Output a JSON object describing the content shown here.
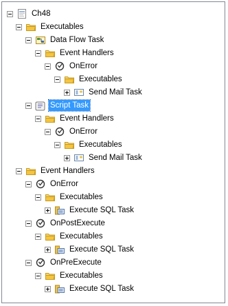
{
  "tree": {
    "root": "Ch48",
    "n_executables": "Executables",
    "n_dataflow": "Data Flow Task",
    "n_df_eh": "Event Handlers",
    "n_df_onerror": "OnError",
    "n_df_exec": "Executables",
    "n_df_sendmail": "Send Mail Task",
    "n_script": "Script Task",
    "n_sc_eh": "Event Handlers",
    "n_sc_onerror": "OnError",
    "n_sc_exec": "Executables",
    "n_sc_sendmail": "Send Mail Task",
    "n_eventhandlers": "Event Handlers",
    "n_onerror": "OnError",
    "n_onerror_exec": "Executables",
    "n_onerror_sql": "Execute SQL Task",
    "n_onpostexec": "OnPostExecute",
    "n_onpostexec_exec": "Executables",
    "n_onpostexec_sql": "Execute SQL Task",
    "n_onpreexec": "OnPreExecute",
    "n_onpreexec_exec": "Executables",
    "n_onpreexec_sql": "Execute SQL Task"
  },
  "selected": "n_script",
  "icons": {
    "package": "package-icon",
    "folder": "folder-icon",
    "dataflow": "data-flow-task-icon",
    "script": "script-task-icon",
    "handler": "event-handler-icon",
    "sendmail": "send-mail-task-icon",
    "sql": "execute-sql-task-icon"
  },
  "colors": {
    "selection": "#3399ff",
    "folder": "#f4c542"
  }
}
